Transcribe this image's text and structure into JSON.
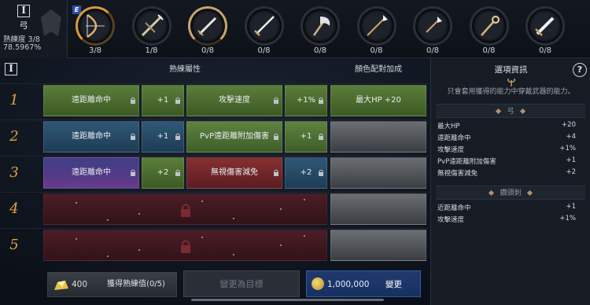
{
  "weapon_info": {
    "roman": "I",
    "name": "弓",
    "level_label": "熟練度 3/8",
    "percent": "78.5967%"
  },
  "weapons": [
    {
      "icon": "bow-icon",
      "count": "3/8",
      "state": "selected",
      "badge": "E"
    },
    {
      "icon": "crossbow-icon",
      "count": "1/8",
      "state": "normal"
    },
    {
      "icon": "dagger-icon",
      "count": "0/8",
      "state": "highlight"
    },
    {
      "icon": "sword-icon",
      "count": "0/8",
      "state": "normal"
    },
    {
      "icon": "axe-icon",
      "count": "0/8",
      "state": "normal"
    },
    {
      "icon": "spear-icon",
      "count": "0/8",
      "state": "normal"
    },
    {
      "icon": "short-spear-icon",
      "count": "0/8",
      "state": "normal"
    },
    {
      "icon": "staff-icon",
      "count": "0/8",
      "state": "normal"
    },
    {
      "icon": "greatsword-icon",
      "count": "0/8",
      "state": "normal"
    }
  ],
  "table": {
    "roman": "I",
    "header_attr": "熟練屬性",
    "header_color": "顏色配對加成",
    "rows": [
      {
        "num": "1",
        "a_name": "遠距離命中",
        "a_val": "+1",
        "b_name": "攻擊速度",
        "b_val": "+1%",
        "bonus": "最大HP +20"
      },
      {
        "num": "2",
        "a_name": "遠距離命中",
        "a_val": "+1",
        "b_name": "PvP遠距離附加傷害",
        "b_val": "+1",
        "bonus": ""
      },
      {
        "num": "3",
        "a_name": "遠距離命中",
        "a_val": "+2",
        "b_name": "無視傷害減免",
        "b_val": "+2",
        "bonus": ""
      },
      {
        "num": "4"
      },
      {
        "num": "5"
      }
    ]
  },
  "panel": {
    "title": "選項資訊",
    "help": "?",
    "subtitle": "只會套用獲得的能力中穿戴武器的能力。",
    "section1": "弓",
    "stats1": [
      {
        "name": "最大HP",
        "val": "+20"
      },
      {
        "name": "遠距離命中",
        "val": "+4"
      },
      {
        "name": "攻擊速度",
        "val": "+1%"
      },
      {
        "name": "PvP遠距離附加傷害",
        "val": "+1"
      },
      {
        "name": "無視傷害減免",
        "val": "+2"
      }
    ],
    "section2": "鑽頭刺",
    "stats2": [
      {
        "name": "近距離命中",
        "val": "+1"
      },
      {
        "name": "攻擊速度",
        "val": "+1%"
      }
    ]
  },
  "bottom": {
    "material_count": "400",
    "gain_label": "獲得熟練值(0/5)",
    "target_label": "變更為目標",
    "cost": "1,000,000",
    "change_label": "變更"
  }
}
